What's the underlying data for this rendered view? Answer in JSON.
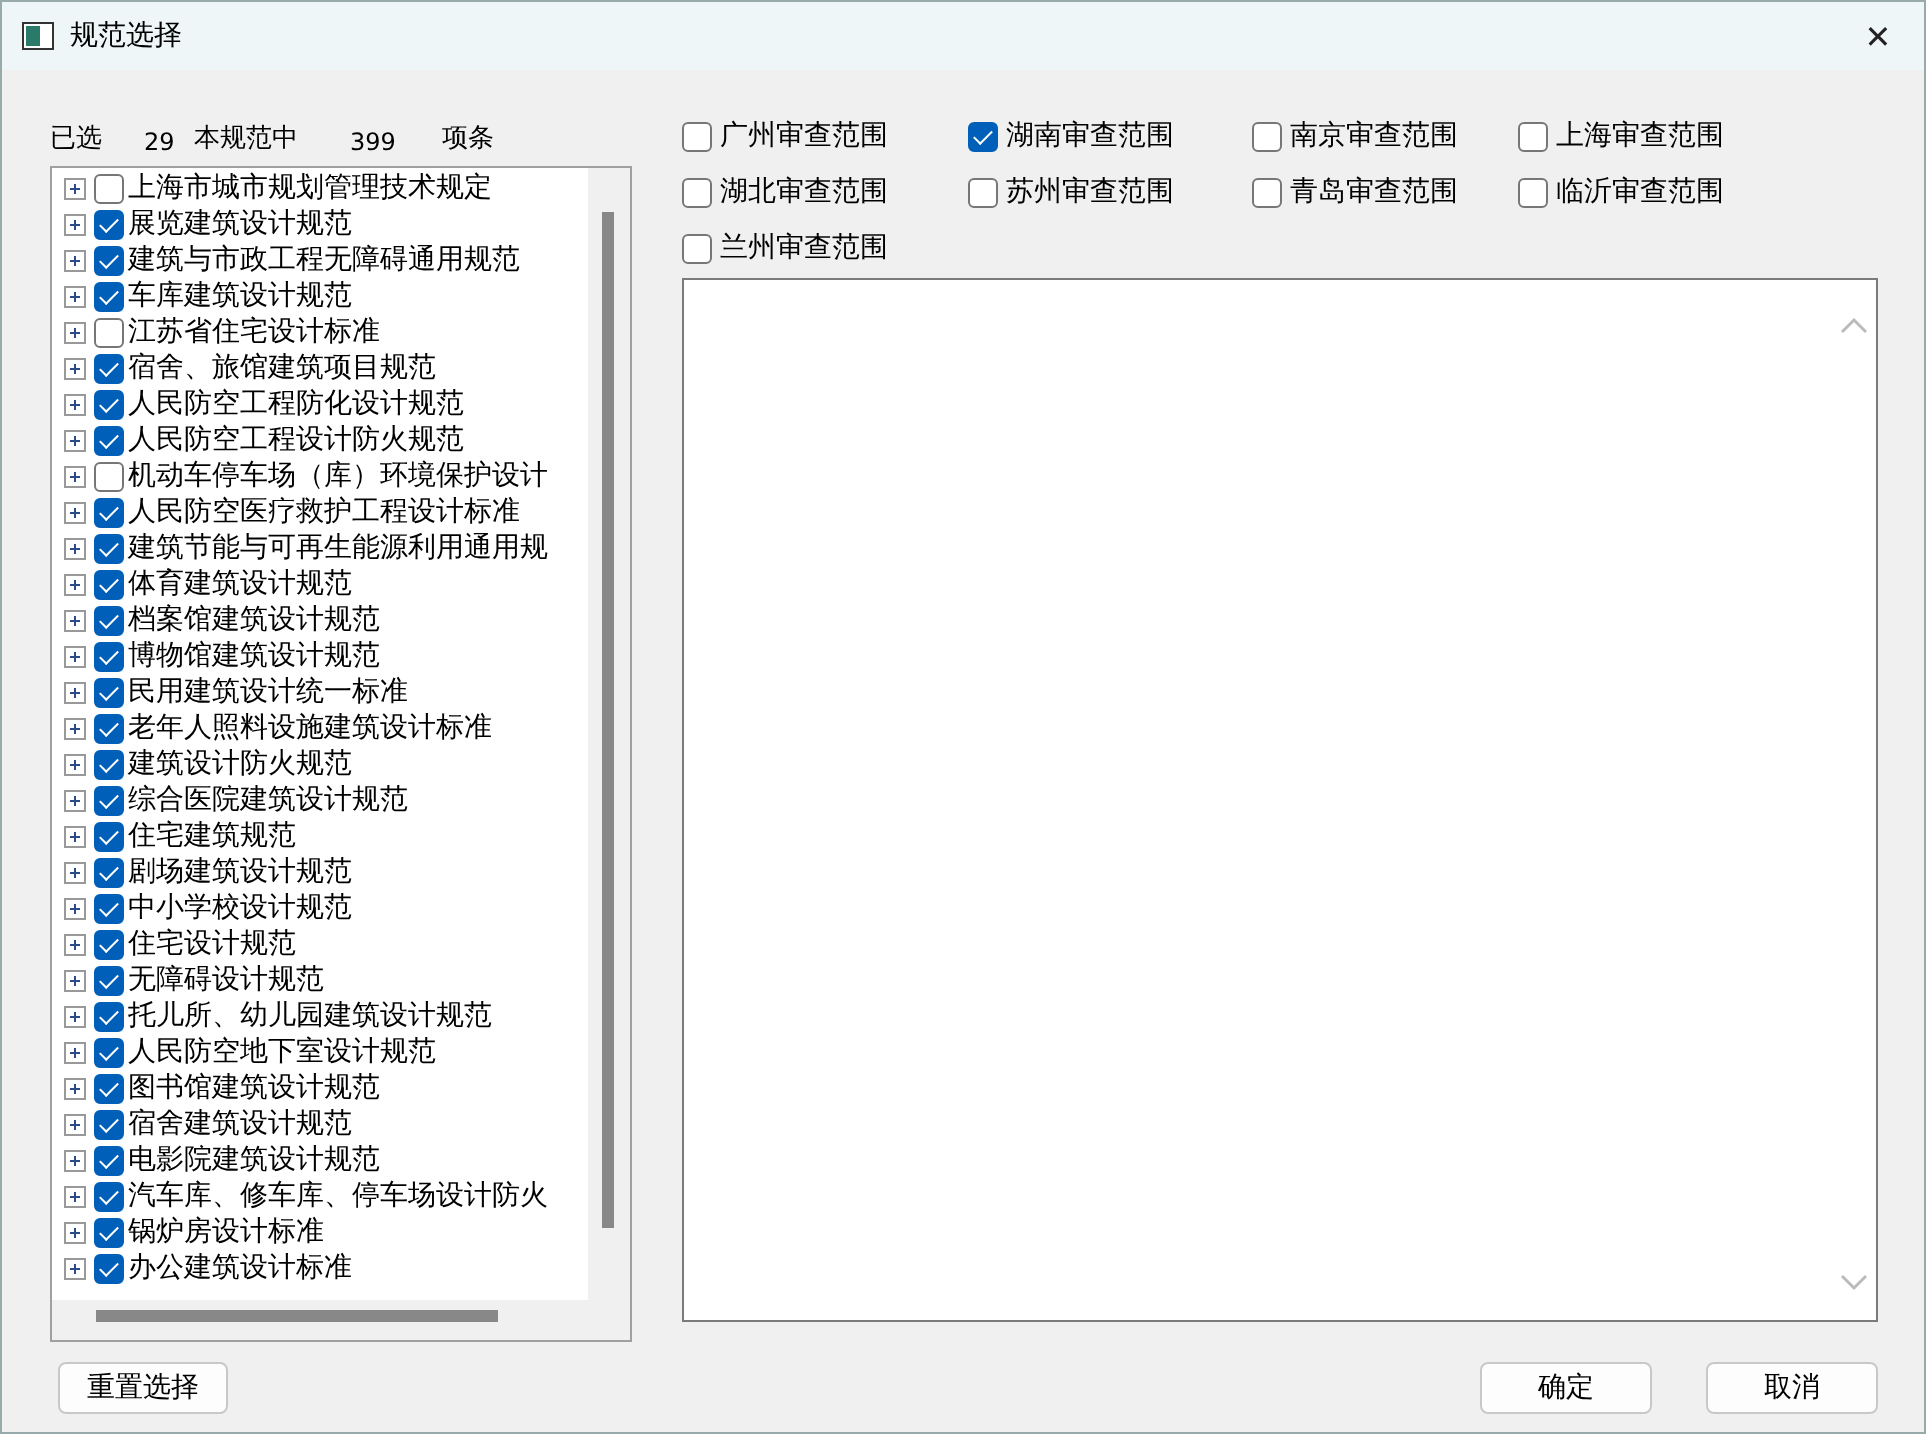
{
  "window": {
    "title": "规范选择",
    "close": "✕"
  },
  "summary": {
    "selected_label": "已选",
    "selected_count": "29",
    "total_label": "本规范中",
    "total_count": "399",
    "unit": "项条"
  },
  "tree": {
    "items": [
      {
        "label": "上海市城市规划管理技术规定",
        "checked": false
      },
      {
        "label": "展览建筑设计规范",
        "checked": true
      },
      {
        "label": "建筑与市政工程无障碍通用规范",
        "checked": true
      },
      {
        "label": "车库建筑设计规范",
        "checked": true
      },
      {
        "label": "江苏省住宅设计标准",
        "checked": false
      },
      {
        "label": "宿舍、旅馆建筑项目规范",
        "checked": true
      },
      {
        "label": "人民防空工程防化设计规范",
        "checked": true
      },
      {
        "label": "人民防空工程设计防火规范",
        "checked": true
      },
      {
        "label": "机动车停车场（库）环境保护设计",
        "checked": false
      },
      {
        "label": "人民防空医疗救护工程设计标准",
        "checked": true
      },
      {
        "label": "建筑节能与可再生能源利用通用规",
        "checked": true
      },
      {
        "label": "体育建筑设计规范",
        "checked": true
      },
      {
        "label": "档案馆建筑设计规范",
        "checked": true
      },
      {
        "label": "博物馆建筑设计规范",
        "checked": true
      },
      {
        "label": "民用建筑设计统一标准",
        "checked": true
      },
      {
        "label": "老年人照料设施建筑设计标准",
        "checked": true
      },
      {
        "label": "建筑设计防火规范",
        "checked": true
      },
      {
        "label": "综合医院建筑设计规范",
        "checked": true
      },
      {
        "label": "住宅建筑规范",
        "checked": true
      },
      {
        "label": "剧场建筑设计规范",
        "checked": true
      },
      {
        "label": "中小学校设计规范",
        "checked": true
      },
      {
        "label": "住宅设计规范",
        "checked": true
      },
      {
        "label": "无障碍设计规范",
        "checked": true
      },
      {
        "label": "托儿所、幼儿园建筑设计规范",
        "checked": true
      },
      {
        "label": "人民防空地下室设计规范",
        "checked": true
      },
      {
        "label": "图书馆建筑设计规范",
        "checked": true
      },
      {
        "label": "宿舍建筑设计规范",
        "checked": true
      },
      {
        "label": "电影院建筑设计规范",
        "checked": true
      },
      {
        "label": "汽车库、修车库、停车场设计防火",
        "checked": true
      },
      {
        "label": "锅炉房设计标准",
        "checked": true
      },
      {
        "label": "办公建筑设计标准",
        "checked": true
      }
    ]
  },
  "scopes": [
    {
      "label": "广州审查范围",
      "checked": false
    },
    {
      "label": "湖南审查范围",
      "checked": true
    },
    {
      "label": "南京审查范围",
      "checked": false
    },
    {
      "label": "上海审查范围",
      "checked": false
    },
    {
      "label": "湖北审查范围",
      "checked": false
    },
    {
      "label": "苏州审查范围",
      "checked": false
    },
    {
      "label": "青岛审查范围",
      "checked": false
    },
    {
      "label": "临沂审查范围",
      "checked": false
    },
    {
      "label": "兰州审查范围",
      "checked": false
    }
  ],
  "buttons": {
    "reset": "重置选择",
    "ok": "确定",
    "cancel": "取消"
  }
}
